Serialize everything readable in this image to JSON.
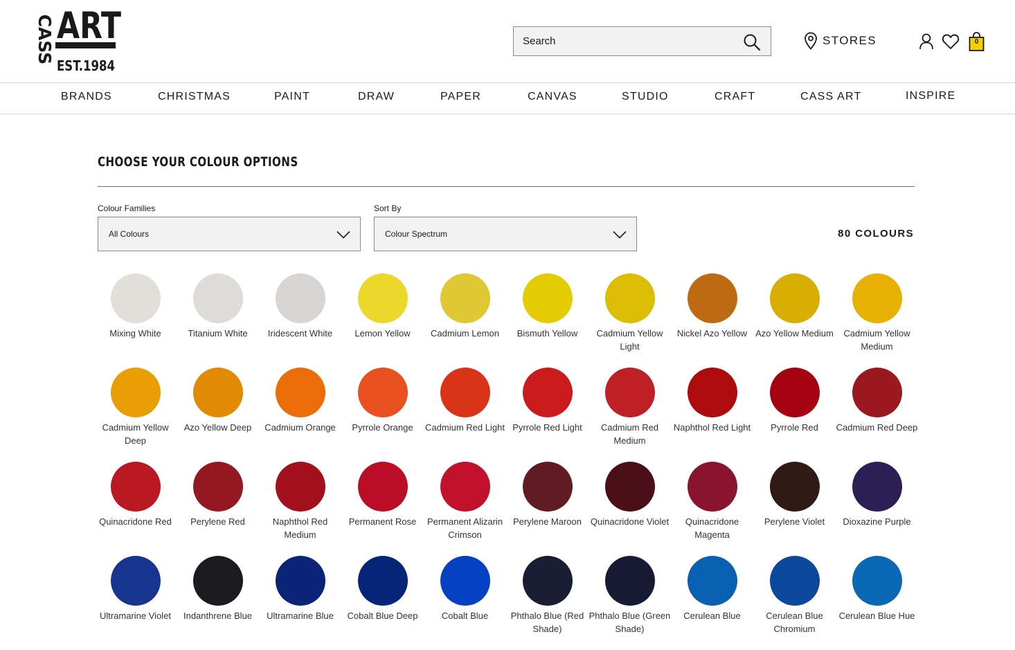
{
  "header": {
    "logo": {
      "text_left": "CASS",
      "text_right": "ART",
      "est": "EST.1984"
    },
    "search": {
      "placeholder": "Search"
    },
    "stores_label": "STORES",
    "bag_count": "0"
  },
  "nav": [
    "BRANDS",
    "CHRISTMAS",
    "PAINT",
    "DRAW",
    "PAPER",
    "CANVAS",
    "STUDIO",
    "CRAFT",
    "CASS ART",
    "INSPIRE"
  ],
  "main": {
    "title": "CHOOSE YOUR COLOUR OPTIONS",
    "families_label": "Colour Families",
    "families_value": "All Colours",
    "sort_label": "Sort By",
    "sort_value": "Colour Spectrum",
    "count": "80 COLOURS"
  },
  "swatches": [
    {
      "name": "Mixing White",
      "color": "#e2dfda"
    },
    {
      "name": "Titanium White",
      "color": "#dddcd8"
    },
    {
      "name": "Iridescent White",
      "color": "#d7d4d4"
    },
    {
      "name": "Lemon Yellow",
      "color": "#ecd82b"
    },
    {
      "name": "Cadmium Lemon",
      "color": "#e2c734"
    },
    {
      "name": "Bismuth Yellow",
      "color": "#e4cc05"
    },
    {
      "name": "Cadmium Yellow Light",
      "color": "#dcbd04"
    },
    {
      "name": "Nickel Azo Yellow",
      "color": "#bd6a12"
    },
    {
      "name": "Azo Yellow Medium",
      "color": "#d8ad04"
    },
    {
      "name": "Cadmium Yellow Medium",
      "color": "#e8b003"
    },
    {
      "name": "Cadmium Yellow Deep",
      "color": "#ea9e05"
    },
    {
      "name": "Azo Yellow Deep",
      "color": "#e38a05"
    },
    {
      "name": "Cadmium Orange",
      "color": "#ea6d07"
    },
    {
      "name": "Pyrrole Orange",
      "color": "#e8501f"
    },
    {
      "name": "Cadmium Red Light",
      "color": "#da3418"
    },
    {
      "name": "Pyrrole Red Light",
      "color": "#cb1b1d"
    },
    {
      "name": "Cadmium Red Medium",
      "color": "#bf2026"
    },
    {
      "name": "Naphthol Red Light",
      "color": "#ad0b0d"
    },
    {
      "name": "Pyrrole Red",
      "color": "#a50311"
    },
    {
      "name": "Cadmium Red Deep",
      "color": "#9b1820"
    },
    {
      "name": "Quinacridone Red",
      "color": "#ba1822"
    },
    {
      "name": "Perylene Red",
      "color": "#951721"
    },
    {
      "name": "Naphthol Red Medium",
      "color": "#a30f1d"
    },
    {
      "name": "Permanent Rose",
      "color": "#bb0d25"
    },
    {
      "name": "Permanent Alizarin Crimson",
      "color": "#c1112b"
    },
    {
      "name": "Perylene Maroon",
      "color": "#611b22"
    },
    {
      "name": "Quinacridone Violet",
      "color": "#4b0f19"
    },
    {
      "name": "Quinacridone Magenta",
      "color": "#8a1430"
    },
    {
      "name": "Perylene Violet",
      "color": "#311916"
    },
    {
      "name": "Dioxazine Purple",
      "color": "#2b1f56"
    },
    {
      "name": "Ultramarine Violet",
      "color": "#17358e"
    },
    {
      "name": "Indanthrene Blue",
      "color": "#1b1a1f"
    },
    {
      "name": "Ultramarine Blue",
      "color": "#0a2478"
    },
    {
      "name": "Cobalt Blue Deep",
      "color": "#062579"
    },
    {
      "name": "Cobalt Blue",
      "color": "#0641c3"
    },
    {
      "name": "Phthalo Blue (Red Shade)",
      "color": "#191d34"
    },
    {
      "name": "Phthalo Blue (Green Shade)",
      "color": "#161b33"
    },
    {
      "name": "Cerulean Blue",
      "color": "#0a60b3"
    },
    {
      "name": "Cerulean Blue Chromium",
      "color": "#0b479b"
    },
    {
      "name": "Cerulean Blue Hue",
      "color": "#0a67b5"
    }
  ]
}
